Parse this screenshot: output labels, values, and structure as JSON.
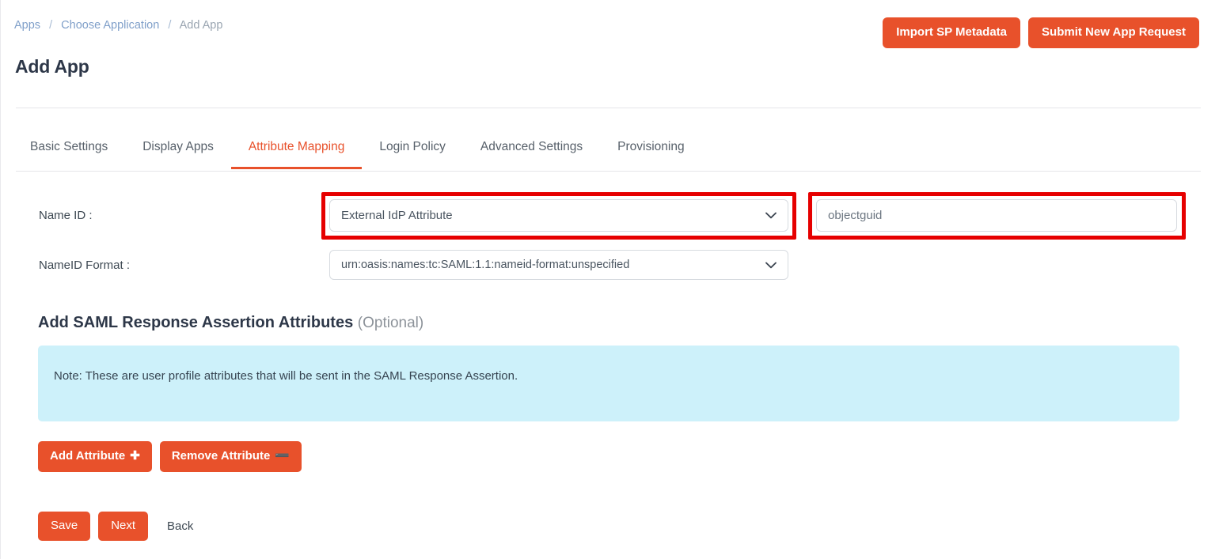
{
  "breadcrumb": {
    "items": [
      {
        "label": "Apps",
        "current": false
      },
      {
        "label": "Choose Application",
        "current": false
      },
      {
        "label": "Add App",
        "current": true
      }
    ],
    "separator": "/"
  },
  "header": {
    "title": "Add App",
    "actions": {
      "import_sp_metadata": "Import SP Metadata",
      "submit_new_app_request": "Submit New App Request"
    }
  },
  "tabs": [
    {
      "label": "Basic Settings",
      "active": false
    },
    {
      "label": "Display Apps",
      "active": false
    },
    {
      "label": "Attribute Mapping",
      "active": true
    },
    {
      "label": "Login Policy",
      "active": false
    },
    {
      "label": "Advanced Settings",
      "active": false
    },
    {
      "label": "Provisioning",
      "active": false
    }
  ],
  "form": {
    "name_id": {
      "label": "Name ID :",
      "select_value": "External IdP Attribute",
      "attribute_value": "objectguid",
      "chevron_icon": "chevron-down-icon"
    },
    "name_id_format": {
      "label": "NameID Format :",
      "select_value": "urn:oasis:names:tc:SAML:1.1:nameid-format:unspecified",
      "chevron_icon": "chevron-down-icon"
    }
  },
  "assertion_section": {
    "heading": "Add SAML Response Assertion Attributes",
    "heading_optional": "(Optional)",
    "note": "Note: These are user profile attributes that will be sent in the SAML Response Assertion.",
    "add_attribute": "Add Attribute",
    "add_attribute_glyph": "✚",
    "remove_attribute": "Remove Attribute",
    "remove_attribute_glyph": "➖"
  },
  "footer": {
    "save": "Save",
    "next": "Next",
    "back": "Back"
  },
  "colors": {
    "accent_orange": "#e8512b",
    "note_background": "#cdf1fa",
    "annotation_red": "#e60000",
    "link_blue": "#7f9fc9"
  }
}
